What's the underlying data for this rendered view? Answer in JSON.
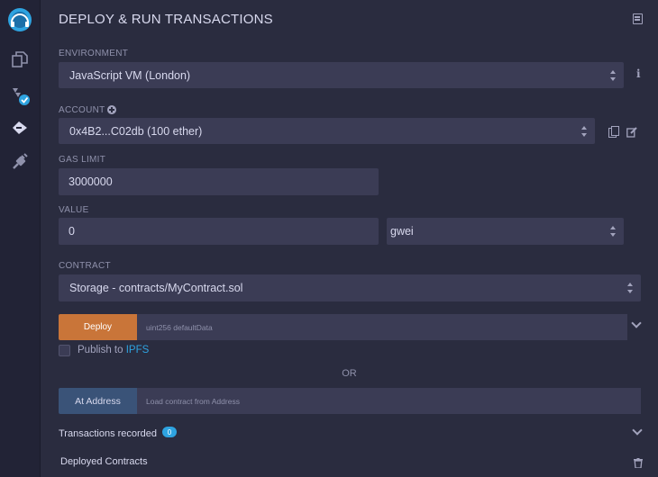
{
  "sidebar": {
    "icons": [
      "remix-logo-icon",
      "file-explorer-icon",
      "solidity-compiler-icon",
      "deploy-run-icon",
      "plugin-manager-icon"
    ]
  },
  "panel": {
    "title": "DEPLOY & RUN TRANSACTIONS"
  },
  "environment": {
    "label": "ENVIRONMENT",
    "value": "JavaScript VM (London)"
  },
  "account": {
    "label": "ACCOUNT",
    "value": "0x4B2...C02db (100 ether)"
  },
  "gas_limit": {
    "label": "GAS LIMIT",
    "value": "3000000"
  },
  "value": {
    "label": "VALUE",
    "amount": "0",
    "unit": "gwei"
  },
  "contract": {
    "label": "CONTRACT",
    "value": "Storage - contracts/MyContract.sol"
  },
  "deploy": {
    "button_label": "Deploy",
    "input_placeholder": "uint256 defaultData"
  },
  "publish": {
    "prefix": "Publish to ",
    "link": "IPFS"
  },
  "or_text": "OR",
  "at_address": {
    "button_label": "At Address",
    "input_placeholder": "Load contract from Address"
  },
  "transactions": {
    "label": "Transactions recorded",
    "count": "0"
  },
  "deployed_contracts": {
    "label": "Deployed Contracts"
  },
  "colors": {
    "accent_orange": "#c97539",
    "accent_blue": "#2ea3e0",
    "panel_bg": "#2a2c3f",
    "field_bg": "#3b3c55"
  }
}
